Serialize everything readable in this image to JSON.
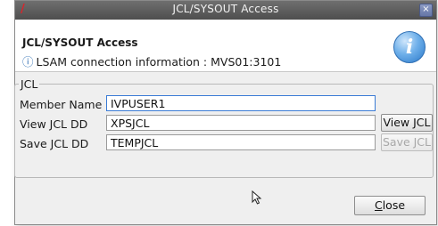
{
  "window": {
    "title": "JCL/SYSOUT Access",
    "close_glyph": "×",
    "app_icon": "red-slash-icon"
  },
  "header": {
    "title": "JCL/SYSOUT Access",
    "info_glyph": "ⓘ",
    "info_text": "LSAM connection information : MVS01:3101",
    "big_icon_glyph": "i"
  },
  "group": {
    "label": "JCL",
    "rows": [
      {
        "label": "Member Name",
        "value": "IVPUSER1"
      },
      {
        "label": "View JCL DD",
        "value": "XPSJCL",
        "button": "View JCL",
        "button_enabled": true
      },
      {
        "label": "Save JCL DD",
        "value": "TEMPJCL",
        "button": "Save JCL",
        "button_enabled": false
      }
    ]
  },
  "footer": {
    "close_label": "Close"
  },
  "colors": {
    "titlebar": "#5a5a5a",
    "accent": "#2f6fb4",
    "focus_border": "#3a7bd5"
  }
}
